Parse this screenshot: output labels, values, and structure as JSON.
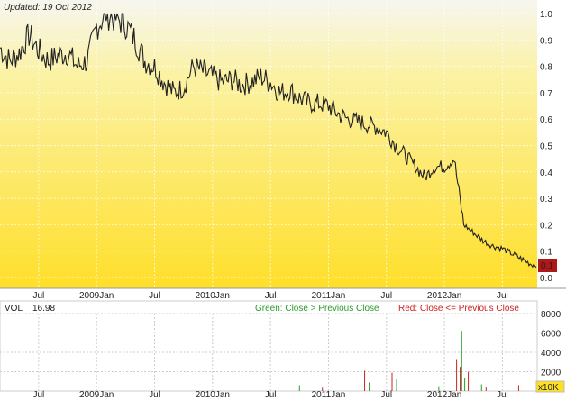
{
  "chart_data": [
    {
      "type": "line",
      "updated": "Updated: 19 Oct 2012",
      "x_ticks": [
        "Jul",
        "2009Jan",
        "Jul",
        "2010Jan",
        "Jul",
        "2011Jan",
        "Jul",
        "2012Jan",
        "Jul"
      ],
      "y_ticks": [
        "1.0",
        "0.9",
        "0.8",
        "0.7",
        "0.6",
        "0.5",
        "0.4",
        "0.3",
        "0.2",
        "0.1",
        "0.0"
      ],
      "ylim": [
        0,
        1.0
      ],
      "last_value_badge": "0.1",
      "series": [
        {
          "x": [
            "2008-03",
            "2008-04",
            "2008-05",
            "2008-06",
            "2008-07",
            "2008-08",
            "2008-09",
            "2008-10",
            "2008-11",
            "2008-12",
            "2009-01",
            "2009-02",
            "2009-03",
            "2009-04",
            "2009-05",
            "2009-06",
            "2009-07",
            "2009-08",
            "2009-09",
            "2009-10",
            "2009-11",
            "2009-12",
            "2010-01",
            "2010-02",
            "2010-03",
            "2010-04",
            "2010-05",
            "2010-06",
            "2010-07",
            "2010-08",
            "2010-09",
            "2010-10",
            "2010-11",
            "2010-12",
            "2011-01",
            "2011-02",
            "2011-03",
            "2011-04",
            "2011-05",
            "2011-06",
            "2011-07",
            "2011-08",
            "2011-09",
            "2011-10",
            "2011-11",
            "2011-12",
            "2012-01",
            "2012-02",
            "2012-03",
            "2012-04",
            "2012-05",
            "2012-06",
            "2012-07",
            "2012-08",
            "2012-09",
            "2012-10"
          ],
          "values": [
            0.87,
            0.82,
            0.85,
            0.92,
            0.86,
            0.82,
            0.84,
            0.85,
            0.8,
            0.82,
            0.95,
            1.0,
            0.98,
            0.96,
            0.9,
            0.82,
            0.8,
            0.74,
            0.7,
            0.72,
            0.8,
            0.78,
            0.76,
            0.74,
            0.75,
            0.73,
            0.74,
            0.76,
            0.74,
            0.7,
            0.71,
            0.68,
            0.66,
            0.66,
            0.65,
            0.62,
            0.6,
            0.59,
            0.58,
            0.57,
            0.55,
            0.5,
            0.46,
            0.42,
            0.38,
            0.42,
            0.42,
            0.45,
            0.2,
            0.17,
            0.14,
            0.12,
            0.11,
            0.09,
            0.07,
            0.05
          ]
        }
      ]
    },
    {
      "type": "bar",
      "indicator": "VOL",
      "indicator_value": "16.98",
      "legend": {
        "green": "Green: Close > Previous Close",
        "red": "Red: Close <= Previous Close"
      },
      "unit_badge": "x10K",
      "y_ticks": [
        "8000",
        "6000",
        "4000",
        "2000"
      ],
      "ylim": [
        0,
        8000
      ],
      "x_ticks": [
        "Jul",
        "2009Jan",
        "Jul",
        "2010Jan",
        "Jul",
        "2011Jan",
        "Jul",
        "2012Jan",
        "Jul"
      ],
      "spikes": [
        {
          "date": "2010-10",
          "value": 600,
          "color": "green"
        },
        {
          "date": "2010-12",
          "value": 350,
          "color": "red"
        },
        {
          "date": "2011-04",
          "value": 2100,
          "color": "red"
        },
        {
          "date": "2011-05",
          "value": 900,
          "color": "green"
        },
        {
          "date": "2011-07",
          "value": 1900,
          "color": "red"
        },
        {
          "date": "2011-08",
          "value": 1200,
          "color": "green"
        },
        {
          "date": "2011-12",
          "value": 500,
          "color": "green"
        },
        {
          "date": "2012-02",
          "value": 6200,
          "color": "green"
        },
        {
          "date": "2012-02",
          "value": 3300,
          "color": "red"
        },
        {
          "date": "2012-02",
          "value": 2500,
          "color": "red"
        },
        {
          "date": "2012-03",
          "value": 1300,
          "color": "green"
        },
        {
          "date": "2012-03",
          "value": 2000,
          "color": "red"
        },
        {
          "date": "2012-04",
          "value": 700,
          "color": "green"
        },
        {
          "date": "2012-05",
          "value": 400,
          "color": "red"
        },
        {
          "date": "2012-08",
          "value": 600,
          "color": "red"
        }
      ]
    }
  ],
  "colors": {
    "grad_top": "#f4f4e0",
    "grad_bottom": "#ffe030",
    "line": "#222222",
    "green": "#2a9a2a",
    "red": "#cc2222",
    "badge": "#b01818"
  }
}
